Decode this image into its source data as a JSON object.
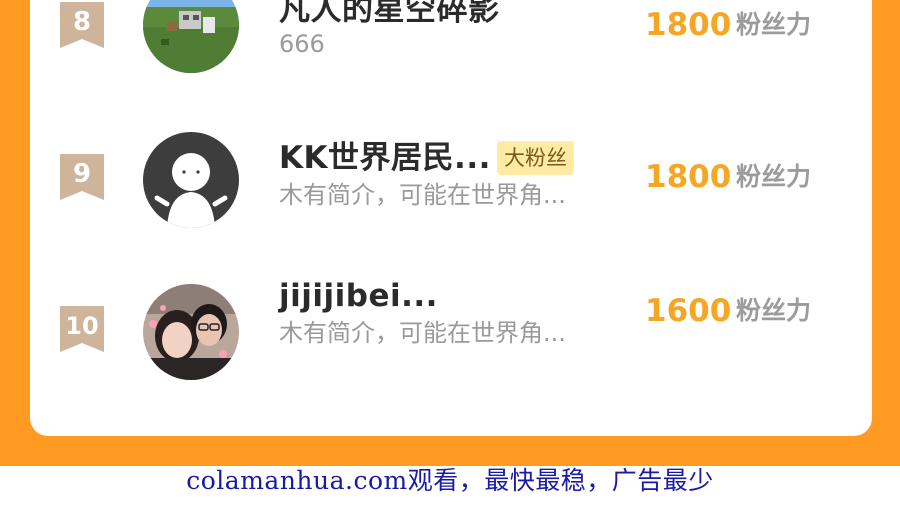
{
  "leaderboard": {
    "unit_label": "粉丝力",
    "rows": [
      {
        "rank": "8",
        "name": "凡人的星空碎影",
        "description": "666",
        "badge": "",
        "fans": "1800"
      },
      {
        "rank": "9",
        "name": "KK世界居民...",
        "description": "木有简介，可能在世界角...",
        "badge": "大粉丝",
        "fans": "1800"
      },
      {
        "rank": "10",
        "name": "jijijibei...",
        "description": "木有简介，可能在世界角...",
        "badge": "",
        "fans": "1600"
      }
    ]
  },
  "watermark": {
    "text": "colamanhua.com观看，最快最稳，广告最少"
  },
  "colors": {
    "background_orange": "#FF9A22",
    "fan_number": "#F6A623",
    "badge_bg": "#FFEBA3",
    "rank_badge": "#CDB49B",
    "watermark_text": "#1a1aa6"
  },
  "icons": {
    "rank_badge": "ribbon-bookmark-icon"
  }
}
